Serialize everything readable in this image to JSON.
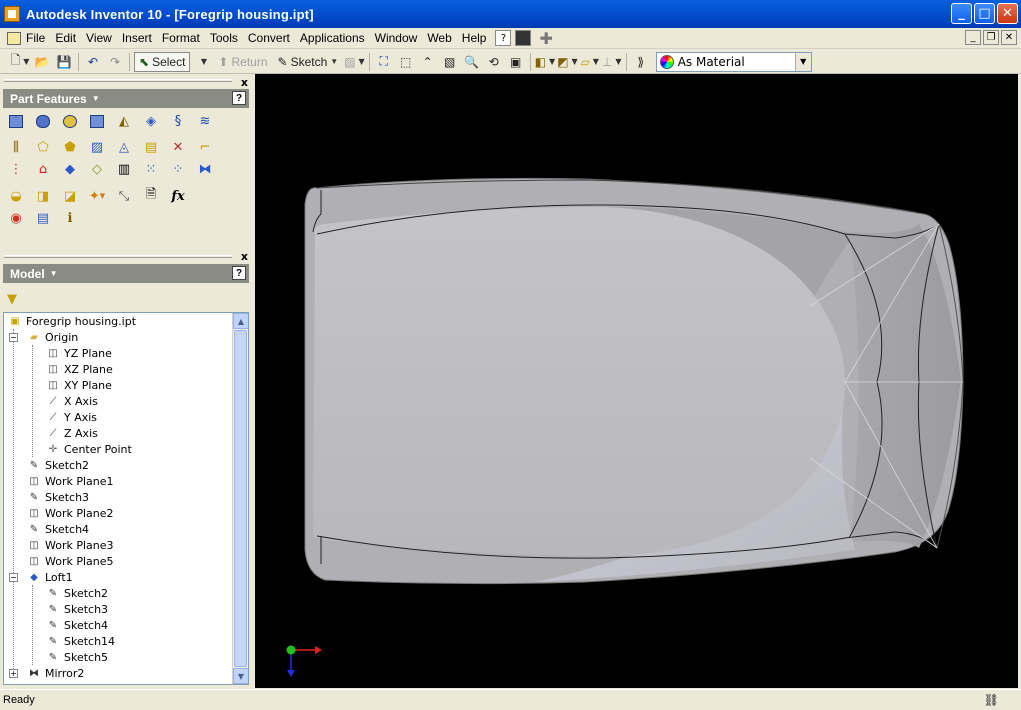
{
  "window": {
    "title": "Autodesk Inventor 10 - [Foregrip housing.ipt]",
    "minimize": "_",
    "maximize": "□",
    "close": "✕"
  },
  "menu": {
    "items": [
      "File",
      "Edit",
      "View",
      "Insert",
      "Format",
      "Tools",
      "Convert",
      "Applications",
      "Window",
      "Web",
      "Help"
    ],
    "help_icon": "?",
    "mdi": [
      "_",
      "❐",
      "✕"
    ]
  },
  "toolbar": {
    "select_label": "Select",
    "return_label": "Return",
    "sketch_label": "Sketch",
    "material_value": "As Material"
  },
  "part_features": {
    "title": "Part Features",
    "help": "?",
    "close": "x"
  },
  "model_browser": {
    "title": "Model",
    "help": "?",
    "close": "x",
    "tree": [
      {
        "label": "Foregrip housing.ipt",
        "icon": "part-icon",
        "level": 0
      },
      {
        "label": "Origin",
        "icon": "folder-icon",
        "level": 1,
        "expander": "−"
      },
      {
        "label": "YZ Plane",
        "icon": "plane-icon",
        "level": 2
      },
      {
        "label": "XZ Plane",
        "icon": "plane-icon",
        "level": 2
      },
      {
        "label": "XY Plane",
        "icon": "plane-icon",
        "level": 2
      },
      {
        "label": "X Axis",
        "icon": "axis-icon",
        "level": 2
      },
      {
        "label": "Y Axis",
        "icon": "axis-icon",
        "level": 2
      },
      {
        "label": "Z Axis",
        "icon": "axis-icon",
        "level": 2
      },
      {
        "label": "Center Point",
        "icon": "point-icon",
        "level": 2
      },
      {
        "label": "Sketch2",
        "icon": "sketch-icon",
        "level": 1
      },
      {
        "label": "Work Plane1",
        "icon": "workplane-icon",
        "level": 1
      },
      {
        "label": "Sketch3",
        "icon": "sketch-icon",
        "level": 1
      },
      {
        "label": "Work Plane2",
        "icon": "workplane-icon",
        "level": 1
      },
      {
        "label": "Sketch4",
        "icon": "sketch-icon",
        "level": 1
      },
      {
        "label": "Work Plane3",
        "icon": "workplane-icon",
        "level": 1
      },
      {
        "label": "Work Plane5",
        "icon": "workplane-icon",
        "level": 1
      },
      {
        "label": "Loft1",
        "icon": "loft-icon",
        "level": 1,
        "expander": "−"
      },
      {
        "label": "Sketch2",
        "icon": "sketch-icon",
        "level": 2
      },
      {
        "label": "Sketch3",
        "icon": "sketch-icon",
        "level": 2
      },
      {
        "label": "Sketch4",
        "icon": "sketch-icon",
        "level": 2
      },
      {
        "label": "Sketch14",
        "icon": "sketch-icon",
        "level": 2
      },
      {
        "label": "Sketch5",
        "icon": "sketch-icon",
        "level": 2
      },
      {
        "label": "Mirror2",
        "icon": "mirror-icon",
        "level": 1,
        "expander": "+"
      }
    ]
  },
  "status": {
    "text": "Ready"
  },
  "colors": {
    "title_bar": "#0352D0",
    "panel_header": "#8A8B82",
    "viewport_bg": "#000000",
    "model_surface": "#B4B4B8"
  }
}
